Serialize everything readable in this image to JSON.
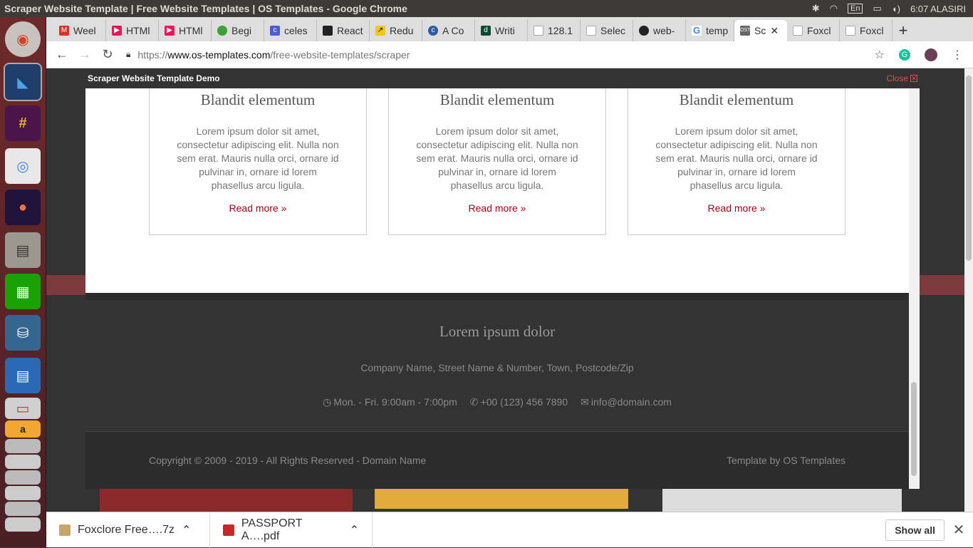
{
  "window": {
    "title": "Scraper Website Template | Free Website Templates | OS Templates - Google Chrome"
  },
  "tray": {
    "lang": "En",
    "clock": "6:07 ALASIRI"
  },
  "tabs": [
    {
      "label": "Weel",
      "color": "#d93025"
    },
    {
      "label": "HTMl",
      "color": "#e8175d"
    },
    {
      "label": "HTMl",
      "color": "#e8175d"
    },
    {
      "label": "Begi",
      "color": "#3fa037"
    },
    {
      "label": "celes",
      "color": "#4f5bd5"
    },
    {
      "label": "React",
      "color": "#222"
    },
    {
      "label": "Redu",
      "color": "#f5c518"
    },
    {
      "label": "A Co",
      "color": "#2a5caa"
    },
    {
      "label": "Writi",
      "color": "#0c4b33"
    },
    {
      "label": "128.1",
      "color": "#aaa"
    },
    {
      "label": "Selec",
      "color": "#aaa"
    },
    {
      "label": "web-",
      "color": "#222"
    },
    {
      "label": "temp",
      "color": "#4285f4"
    },
    {
      "label": "Sc",
      "color": "#666"
    },
    {
      "label": "Foxcl",
      "color": "#aaa"
    },
    {
      "label": "Foxcl",
      "color": "#aaa"
    }
  ],
  "address": {
    "scheme": "https://",
    "host": "www.os-templates.com",
    "path": "/free-website-templates/scraper"
  },
  "modal": {
    "title": "Scraper Website Template Demo",
    "close_label": "Close"
  },
  "cards": [
    {
      "title": "Blandit elementum",
      "text": "Lorem ipsum dolor sit amet, consectetur adipiscing elit. Nulla non sem erat. Mauris nulla orci, ornare id pulvinar in, ornare id lorem phasellus arcu ligula.",
      "link": "Read more »"
    },
    {
      "title": "Blandit elementum",
      "text": "Lorem ipsum dolor sit amet, consectetur adipiscing elit. Nulla non sem erat. Mauris nulla orci, ornare id pulvinar in, ornare id lorem phasellus arcu ligula.",
      "link": "Read more »"
    },
    {
      "title": "Blandit elementum",
      "text": "Lorem ipsum dolor sit amet, consectetur adipiscing elit. Nulla non sem erat. Mauris nulla orci, ornare id pulvinar in, ornare id lorem phasellus arcu ligula.",
      "link": "Read more »"
    }
  ],
  "footer": {
    "heading": "Lorem ipsum dolor",
    "address": "Company Name, Street Name & Number, Town, Postcode/Zip",
    "hours": "Mon. - Fri. 9:00am - 7:00pm",
    "phone": "+00 (123) 456 7890",
    "email": "info@domain.com",
    "copyright": "Copyright © 2009 - 2019 - All Rights Reserved - Domain Name",
    "credit": "Template by OS Templates"
  },
  "downloads": [
    {
      "name": "Foxclore Free….7z",
      "icon": "archive-icon"
    },
    {
      "name": "PASSPORT A….pdf",
      "icon": "pdf-icon"
    }
  ],
  "downloads_bar": {
    "show_all": "Show all"
  }
}
